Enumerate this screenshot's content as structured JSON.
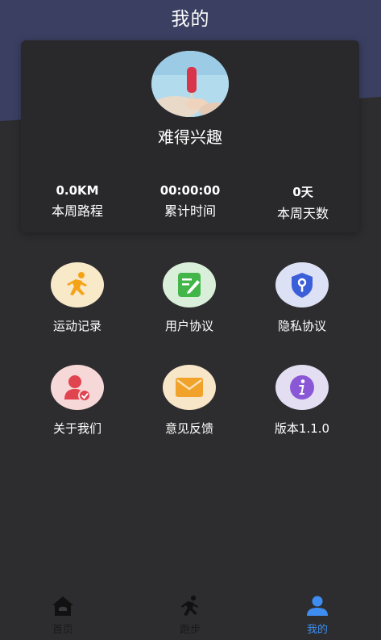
{
  "page": {
    "title": "我的"
  },
  "profile": {
    "username": "难得兴趣",
    "stats": [
      {
        "value": "0.0KM",
        "label": "本周路程"
      },
      {
        "value": "00:00:00",
        "label": "累计时间"
      },
      {
        "value": "0天",
        "label": "本周天数"
      }
    ]
  },
  "menu": {
    "items": [
      {
        "label": "运动记录",
        "icon": "running-person-icon"
      },
      {
        "label": "用户协议",
        "icon": "document-edit-icon"
      },
      {
        "label": "隐私协议",
        "icon": "shield-key-icon"
      },
      {
        "label": "关于我们",
        "icon": "user-check-icon"
      },
      {
        "label": "意见反馈",
        "icon": "envelope-icon"
      },
      {
        "label": "版本1.1.0",
        "icon": "info-icon"
      }
    ]
  },
  "tabbar": {
    "items": [
      {
        "label": "首页",
        "icon": "home-icon"
      },
      {
        "label": "跑步",
        "icon": "running-icon"
      },
      {
        "label": "我的",
        "icon": "person-icon",
        "active": true
      }
    ]
  },
  "colors": {
    "header": "#3b4063",
    "background": "#2d2d2f",
    "active_tab": "#3d8ef0"
  }
}
